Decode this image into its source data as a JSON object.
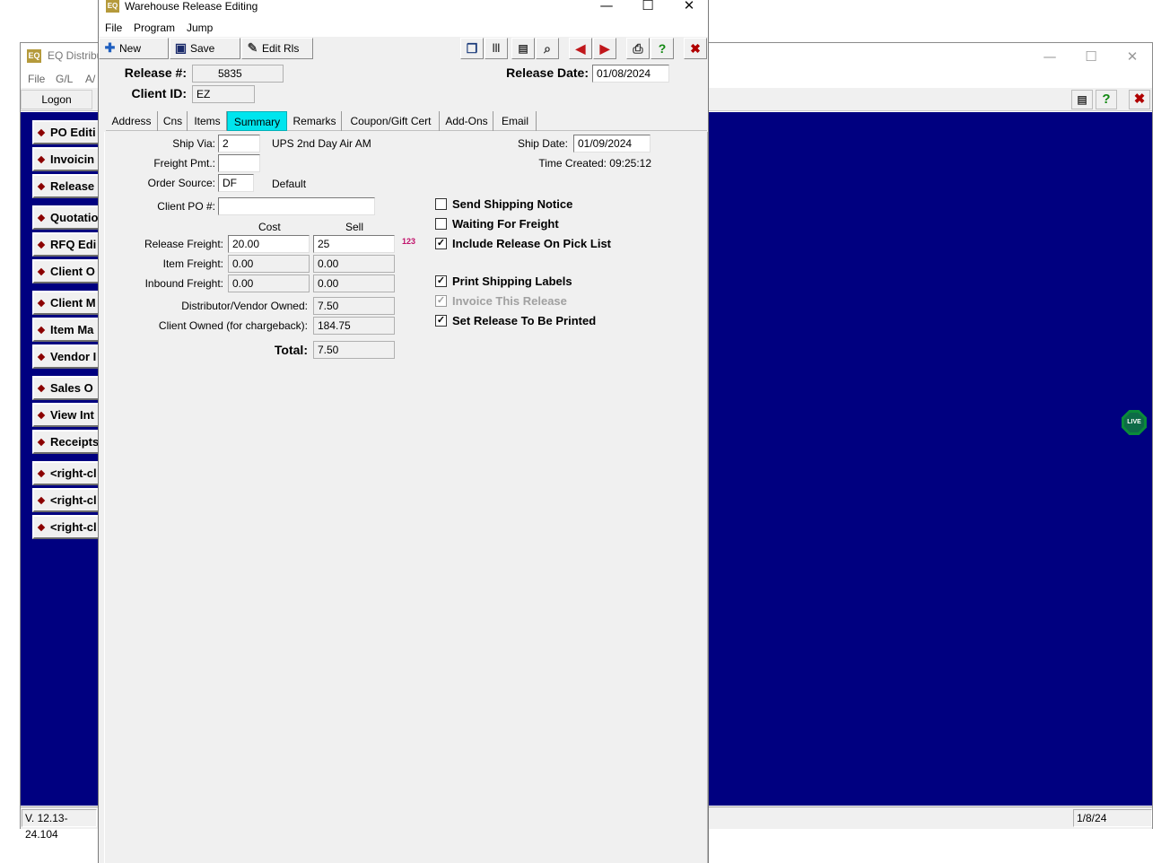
{
  "background_window": {
    "title": "EQ Distribu",
    "icon_text": "EQ",
    "menu": [
      "File",
      "G/L",
      "A/"
    ],
    "logon_label": "Logon",
    "side_buttons": [
      "PO Editi",
      "Invoicin",
      "Release",
      "Quotatio",
      "RFQ Edi",
      "Client O",
      "Client M",
      "Item Ma",
      "Vendor I",
      "Sales O",
      "View Int",
      "Receipts",
      "<right-cl",
      "<right-cl",
      "<right-cl"
    ],
    "status_version": "V. 12.13-24.104",
    "status_date": "1/8/24",
    "live_badge": "LIVE",
    "blue_color": "#000080"
  },
  "window": {
    "title": "Warehouse Release Editing",
    "icon_text": "EQ",
    "minimize": "—",
    "maximize": "☐",
    "close": "✕"
  },
  "menu": [
    "File",
    "Program",
    "Jump"
  ],
  "toolbar": {
    "new_label": "New",
    "save_label": "Save",
    "edit_label": "Edit Rls"
  },
  "header": {
    "release_label": "Release #:",
    "release_value": "5835",
    "client_label": "Client ID:",
    "client_value": "EZ",
    "release_date_label": "Release Date:",
    "release_date_value": "01/08/2024"
  },
  "tabs": [
    "Address",
    "Cns",
    "Items",
    "Summary",
    "Remarks",
    "Coupon/Gift Cert",
    "Add-Ons",
    "Email"
  ],
  "active_tab": "Summary",
  "active_tab_color": "#00e5ee",
  "summary": {
    "ship_via_label": "Ship Via:",
    "ship_via_value": "2",
    "ship_via_desc": "UPS 2nd Day Air AM",
    "freight_pmt_label": "Freight Pmt.:",
    "freight_pmt_value": "",
    "order_source_label": "Order Source:",
    "order_source_value": "DF",
    "order_source_desc": "Default",
    "client_po_label": "Client PO #:",
    "client_po_value": "",
    "ship_date_label": "Ship Date:",
    "ship_date_value": "01/09/2024",
    "time_created": "Time Created: 09:25:12",
    "cost_header": "Cost",
    "sell_header": "Sell",
    "release_freight_label": "Release Freight:",
    "release_freight_cost": "20.00",
    "release_freight_sell": "25",
    "item_freight_label": "Item Freight:",
    "item_freight_cost": "0.00",
    "item_freight_sell": "0.00",
    "inbound_freight_label": "Inbound Freight:",
    "inbound_freight_cost": "0.00",
    "inbound_freight_sell": "0.00",
    "distributor_owned_label": "Distributor/Vendor Owned:",
    "distributor_owned_value": "7.50",
    "client_owned_label": "Client Owned (for chargeback):",
    "client_owned_value": "184.75",
    "total_label": "Total:",
    "total_value": "7.50",
    "calc_icon_text": "123"
  },
  "checkboxes": [
    {
      "label": "Send Shipping Notice",
      "checked": false,
      "disabled": false
    },
    {
      "label": "Waiting For Freight",
      "checked": false,
      "disabled": false
    },
    {
      "label": "Include Release On Pick List",
      "checked": true,
      "disabled": false
    },
    {
      "label": "Print Shipping Labels",
      "checked": true,
      "disabled": false
    },
    {
      "label": "Invoice This Release",
      "checked": true,
      "disabled": true
    },
    {
      "label": "Set Release To Be Printed",
      "checked": true,
      "disabled": false
    }
  ]
}
